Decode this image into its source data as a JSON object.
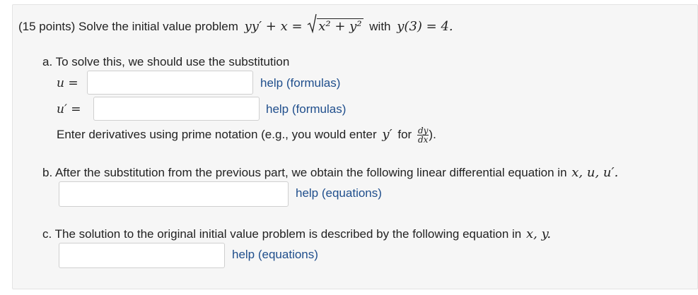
{
  "problem": {
    "intro": "(15 points) Solve the initial value problem",
    "equation_lhs": "yy′ + x =",
    "equation_radicand": "x² + y²",
    "with_text": "with",
    "initial_condition": "y(3) = 4."
  },
  "part_a": {
    "label": "a. To solve this, we should use the substitution",
    "u_label": "u =",
    "u_input_value": "",
    "u_help": "help (formulas)",
    "uprime_label": "u′ =",
    "uprime_input_value": "",
    "uprime_help": "help (formulas)",
    "note_text": "Enter derivatives using prime notation (e.g., you would enter",
    "note_yprime": "y′",
    "note_for": "for",
    "note_frac_num": "dy",
    "note_frac_den": "dx",
    "note_end": ")."
  },
  "part_b": {
    "label": "b. After the substitution from the previous part, we obtain the following linear differential equation in",
    "vars": "x, u, u′.",
    "input_value": "",
    "help": "help (equations)"
  },
  "part_c": {
    "label": "c. The solution to the original initial value problem is described by the following equation in",
    "vars": "x, y.",
    "input_value": "",
    "help": "help (equations)"
  }
}
